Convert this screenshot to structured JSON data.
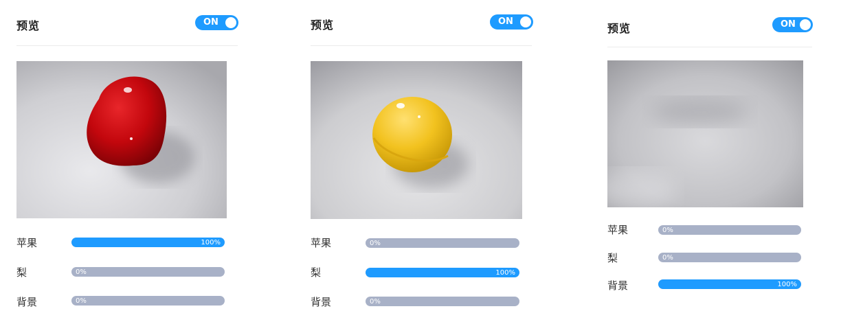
{
  "panels": [
    {
      "title": "预览",
      "toggle": "ON",
      "preview": {
        "subject": "red-apple"
      },
      "predictions": [
        {
          "label": "苹果",
          "percent": 100,
          "text": "100%"
        },
        {
          "label": "梨",
          "percent": 0,
          "text": "0%"
        },
        {
          "label": "背景",
          "percent": 0,
          "text": "0%"
        }
      ]
    },
    {
      "title": "预览",
      "toggle": "ON",
      "preview": {
        "subject": "yellow-ball"
      },
      "predictions": [
        {
          "label": "苹果",
          "percent": 0,
          "text": "0%"
        },
        {
          "label": "梨",
          "percent": 100,
          "text": "100%"
        },
        {
          "label": "背景",
          "percent": 0,
          "text": "0%"
        }
      ]
    },
    {
      "title": "预览",
      "toggle": "ON",
      "preview": {
        "subject": "empty-background"
      },
      "predictions": [
        {
          "label": "苹果",
          "percent": 0,
          "text": "0%"
        },
        {
          "label": "梨",
          "percent": 0,
          "text": "0%"
        },
        {
          "label": "背景",
          "percent": 100,
          "text": "100%"
        }
      ]
    }
  ],
  "colors": {
    "accent": "#1e9bff",
    "bar_track": "#a8b1c7",
    "divider": "#ebebeb"
  }
}
